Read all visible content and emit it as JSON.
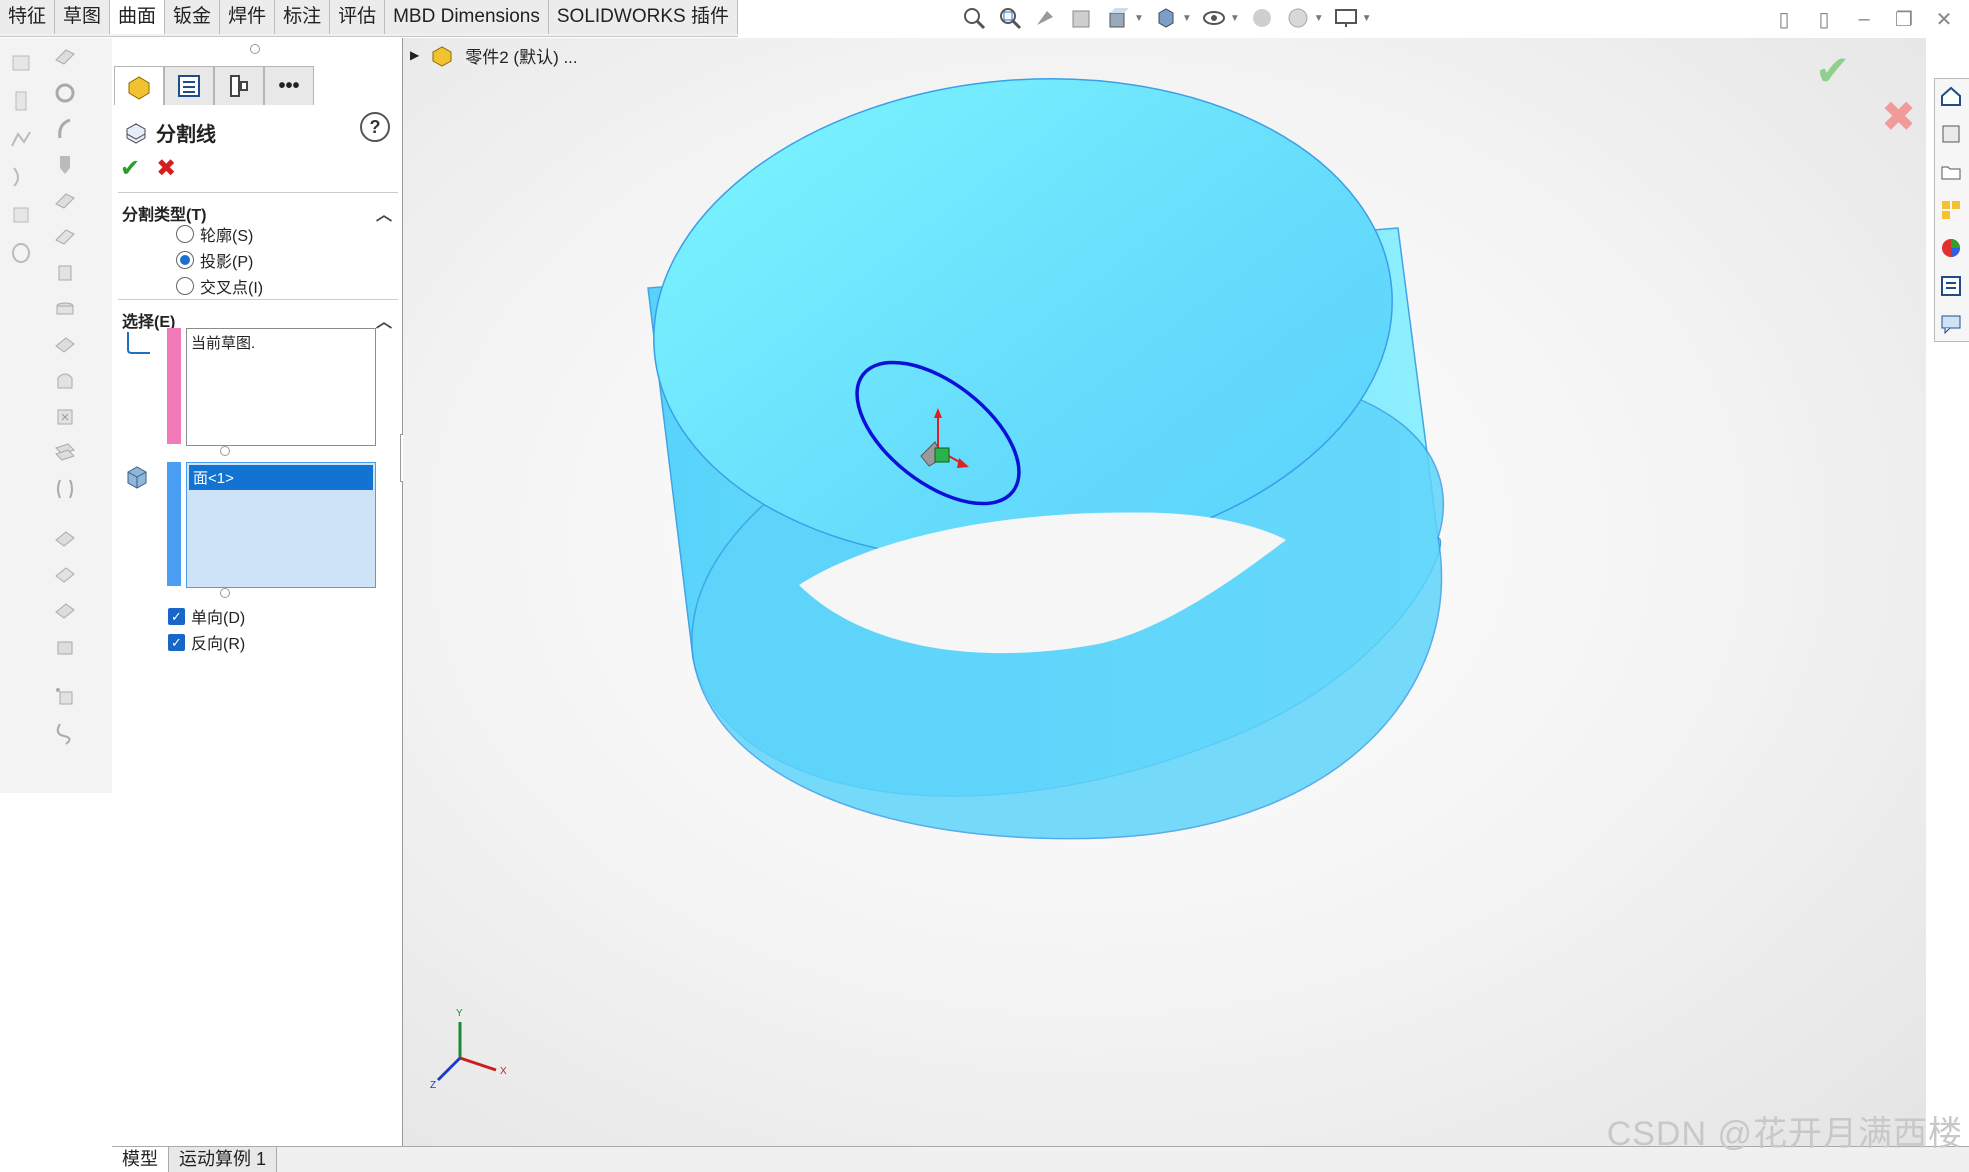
{
  "menu_tabs": [
    "特征",
    "草图",
    "曲面",
    "钣金",
    "焊件",
    "标注",
    "评估",
    "MBD Dimensions",
    "SOLIDWORKS 插件"
  ],
  "active_tab_index": 2,
  "tree": {
    "part_label": "零件2 (默认) ..."
  },
  "property_manager": {
    "title": "分割线",
    "split_type": {
      "header": "分割类型(T)",
      "options": [
        "轮廓(S)",
        "投影(P)",
        "交叉点(I)"
      ],
      "selected": "投影(P)"
    },
    "selection": {
      "header": "选择(E)",
      "sketch_box": "当前草图.",
      "face_item": "面<1>"
    },
    "checkboxes": {
      "single_direction": "单向(D)",
      "reverse_direction": "反向(R)"
    }
  },
  "bottom_tabs": [
    "模型",
    "运动算例 1"
  ],
  "watermark": "CSDN @花开月满西楼",
  "colors": {
    "cylinder": "#5fd8fb",
    "ellipse": "#0a10d8",
    "accent": "#1866c8",
    "pink": "#f27ab9",
    "blue_stripe": "#4a9ef3"
  }
}
